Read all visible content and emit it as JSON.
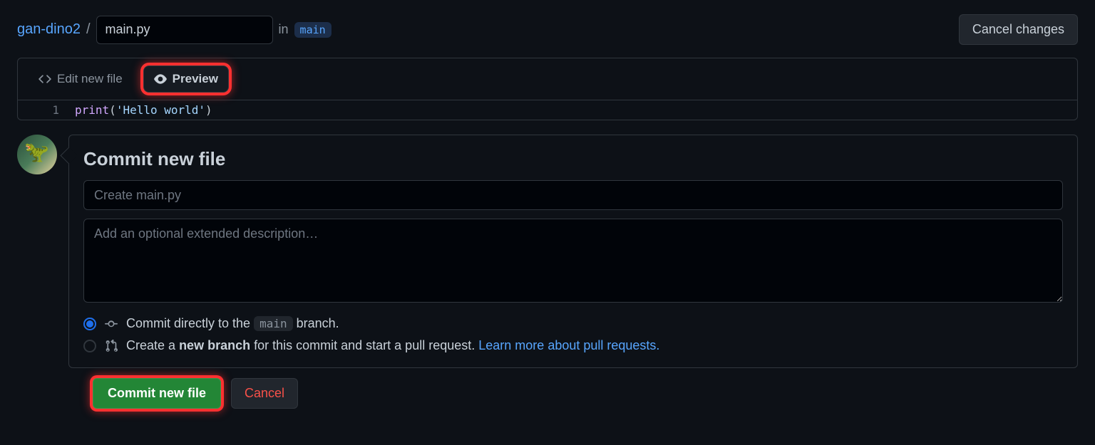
{
  "breadcrumb": {
    "repo": "gan-dino2",
    "separator": "/",
    "filename_value": "main.py",
    "in_label": "in",
    "branch": "main"
  },
  "header": {
    "cancel_changes": "Cancel changes"
  },
  "tabs": {
    "edit": "Edit new file",
    "preview": "Preview"
  },
  "code": {
    "line_num": "1",
    "func": "print",
    "open": "(",
    "str": "'Hello world'",
    "close": ")"
  },
  "commit": {
    "title": "Commit new file",
    "summary_placeholder": "Create main.py",
    "desc_placeholder": "Add an optional extended description…",
    "radio1_pre": "Commit directly to the",
    "radio1_branch": "main",
    "radio1_post": "branch.",
    "radio2_pre": "Create a",
    "radio2_bold": "new branch",
    "radio2_mid": "for this commit and start a pull request.",
    "radio2_link": "Learn more about pull requests.",
    "commit_button": "Commit new file",
    "cancel_button": "Cancel"
  }
}
